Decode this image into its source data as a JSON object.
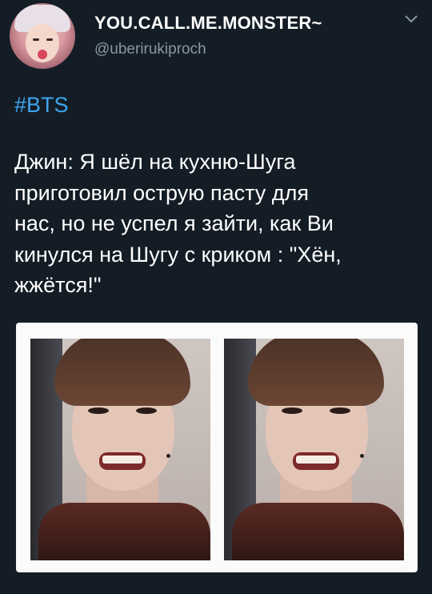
{
  "tweet": {
    "display_name": "YOU.CALL.ME.MONSTER~",
    "handle": "@uberirukiproch",
    "hashtag": "#BTS",
    "lines": [
      "Джин: Я шёл на кухню-Шуга",
      "приготовил острую пасту для",
      "нас, но не успел я зайти, как Ви",
      "кинулся на Шугу с криком : \"Хён,",
      "жжётся!\""
    ]
  },
  "icons": {
    "menu": "chevron-down-icon"
  },
  "colors": {
    "background": "#141d26",
    "hashtag": "#3ea6ef",
    "handle": "#8899a6",
    "card": "#fbfbfb"
  }
}
